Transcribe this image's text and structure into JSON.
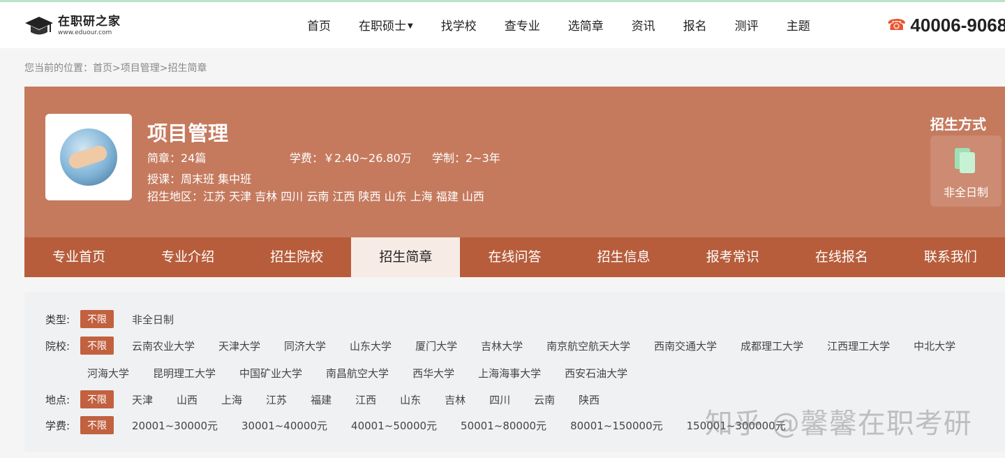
{
  "header": {
    "logo_name": "在职研之家",
    "logo_url": "www.eduour.com",
    "nav": [
      "首页",
      "在职硕士",
      "找学校",
      "查专业",
      "选简章",
      "资讯",
      "报名",
      "测评",
      "主题"
    ],
    "phone": "40006-9068"
  },
  "breadcrumb": "您当前的位置：首页>项目管理>招生简章",
  "banner": {
    "title": "项目管理",
    "brochures": "简章：24篇",
    "tuition": "学费：￥2.40~26.80万",
    "duration": "学制：2~3年",
    "teaching": "授课：周末班 集中班",
    "regions": "招生地区：江苏 天津 吉林 四川 云南 江西 陕西 山东 上海 福建 山西",
    "method_title": "招生方式",
    "method_label": "非全日制"
  },
  "tabs": [
    "专业首页",
    "专业介绍",
    "招生院校",
    "招生简章",
    "在线问答",
    "招生信息",
    "报考常识",
    "在线报名",
    "联系我们"
  ],
  "active_tab": "招生简章",
  "filters": {
    "type_label": "类型:",
    "school_label": "院校:",
    "location_label": "地点:",
    "fee_label": "学费:",
    "unlimited": "不限",
    "types": [
      "非全日制"
    ],
    "schools_row1": [
      "云南农业大学",
      "天津大学",
      "同济大学",
      "山东大学",
      "厦门大学",
      "吉林大学",
      "南京航空航天大学",
      "西南交通大学",
      "成都理工大学",
      "江西理工大学",
      "中北大学"
    ],
    "schools_row2": [
      "河海大学",
      "昆明理工大学",
      "中国矿业大学",
      "南昌航空大学",
      "西华大学",
      "上海海事大学",
      "西安石油大学"
    ],
    "locations": [
      "天津",
      "山西",
      "上海",
      "江苏",
      "福建",
      "江西",
      "山东",
      "吉林",
      "四川",
      "云南",
      "陕西"
    ],
    "fees": [
      "20001~30000元",
      "30001~40000元",
      "40001~50000元",
      "50001~80000元",
      "80001~150000元",
      "150001~300000元"
    ]
  },
  "watermark": "知乎 @馨馨在职考研",
  "colors": {
    "banner": "#c57a5e",
    "tabs": "#b75d3b",
    "selected_chip": "#c1613f",
    "phone_icon": "#e8542e"
  }
}
